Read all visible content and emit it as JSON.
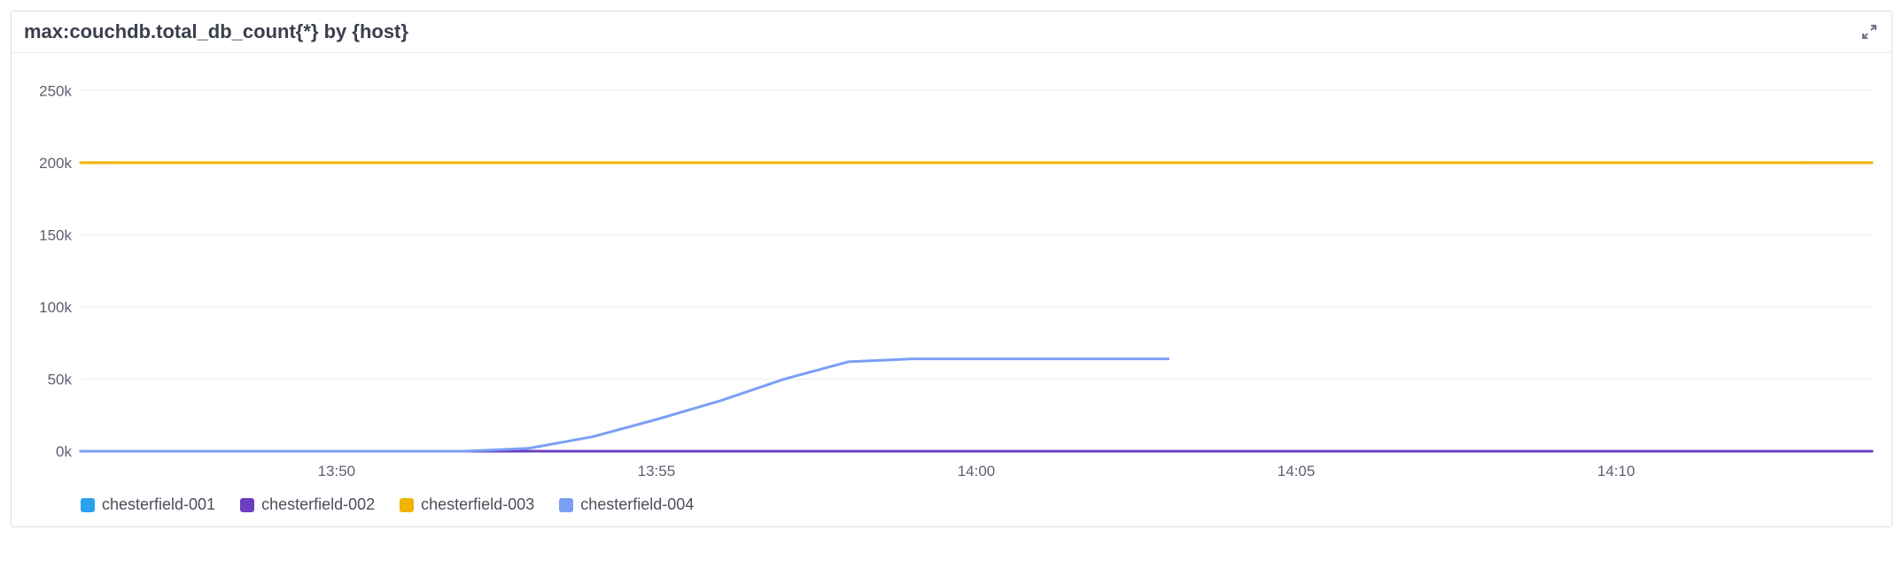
{
  "header": {
    "title": "max:couchdb.total_db_count{*} by {host}"
  },
  "legend": [
    {
      "name": "chesterfield-001",
      "color": "#2aa0f0"
    },
    {
      "name": "chesterfield-002",
      "color": "#6b3fbf"
    },
    {
      "name": "chesterfield-003",
      "color": "#f0b400"
    },
    {
      "name": "chesterfield-004",
      "color": "#7a9ff5"
    }
  ],
  "chart_data": {
    "type": "line",
    "title": "max:couchdb.total_db_count{*} by {host}",
    "xlabel": "",
    "ylabel": "",
    "ylim": [
      0,
      260000
    ],
    "x_ticks": [
      "13:50",
      "13:55",
      "14:00",
      "14:05",
      "14:10"
    ],
    "y_ticks": [
      0,
      50000,
      100000,
      150000,
      200000,
      250000
    ],
    "y_tick_labels": [
      "0k",
      "50k",
      "100k",
      "150k",
      "200k",
      "250k"
    ],
    "x": [
      "13:46",
      "13:47",
      "13:48",
      "13:49",
      "13:50",
      "13:51",
      "13:52",
      "13:53",
      "13:54",
      "13:55",
      "13:56",
      "13:57",
      "13:58",
      "13:59",
      "14:00",
      "14:01",
      "14:02",
      "14:03",
      "14:04",
      "14:05",
      "14:06",
      "14:07",
      "14:08",
      "14:09",
      "14:10",
      "14:11",
      "14:12",
      "14:13",
      "14:14"
    ],
    "series": [
      {
        "name": "chesterfield-001",
        "color": "#2aa0f0",
        "values": [
          0,
          0,
          0,
          0,
          0,
          0,
          0,
          0,
          0,
          0,
          0,
          0,
          0,
          0,
          0,
          0,
          0,
          0,
          0,
          0,
          0,
          0,
          0,
          0,
          0,
          0,
          0,
          0,
          0
        ]
      },
      {
        "name": "chesterfield-002",
        "color": "#6b3fbf",
        "values": [
          0,
          0,
          0,
          0,
          0,
          0,
          0,
          0,
          0,
          0,
          0,
          0,
          0,
          0,
          0,
          0,
          0,
          0,
          0,
          0,
          0,
          0,
          0,
          0,
          0,
          0,
          0,
          0,
          0
        ]
      },
      {
        "name": "chesterfield-003",
        "color": "#f0b400",
        "values": [
          200000,
          200000,
          200000,
          200000,
          200000,
          200000,
          200000,
          200000,
          200000,
          200000,
          200000,
          200000,
          200000,
          200000,
          200000,
          200000,
          200000,
          200000,
          200000,
          200000,
          200000,
          200000,
          200000,
          200000,
          200000,
          200000,
          200000,
          200000,
          200000
        ]
      },
      {
        "name": "chesterfield-004",
        "color": "#7a9ff5",
        "values": [
          0,
          0,
          0,
          0,
          0,
          0,
          0,
          2000,
          10000,
          22000,
          35000,
          50000,
          62000,
          64000,
          64000,
          64000,
          64000,
          64000,
          null,
          null,
          null,
          null,
          null,
          null,
          null,
          null,
          null,
          null,
          null
        ]
      }
    ]
  }
}
